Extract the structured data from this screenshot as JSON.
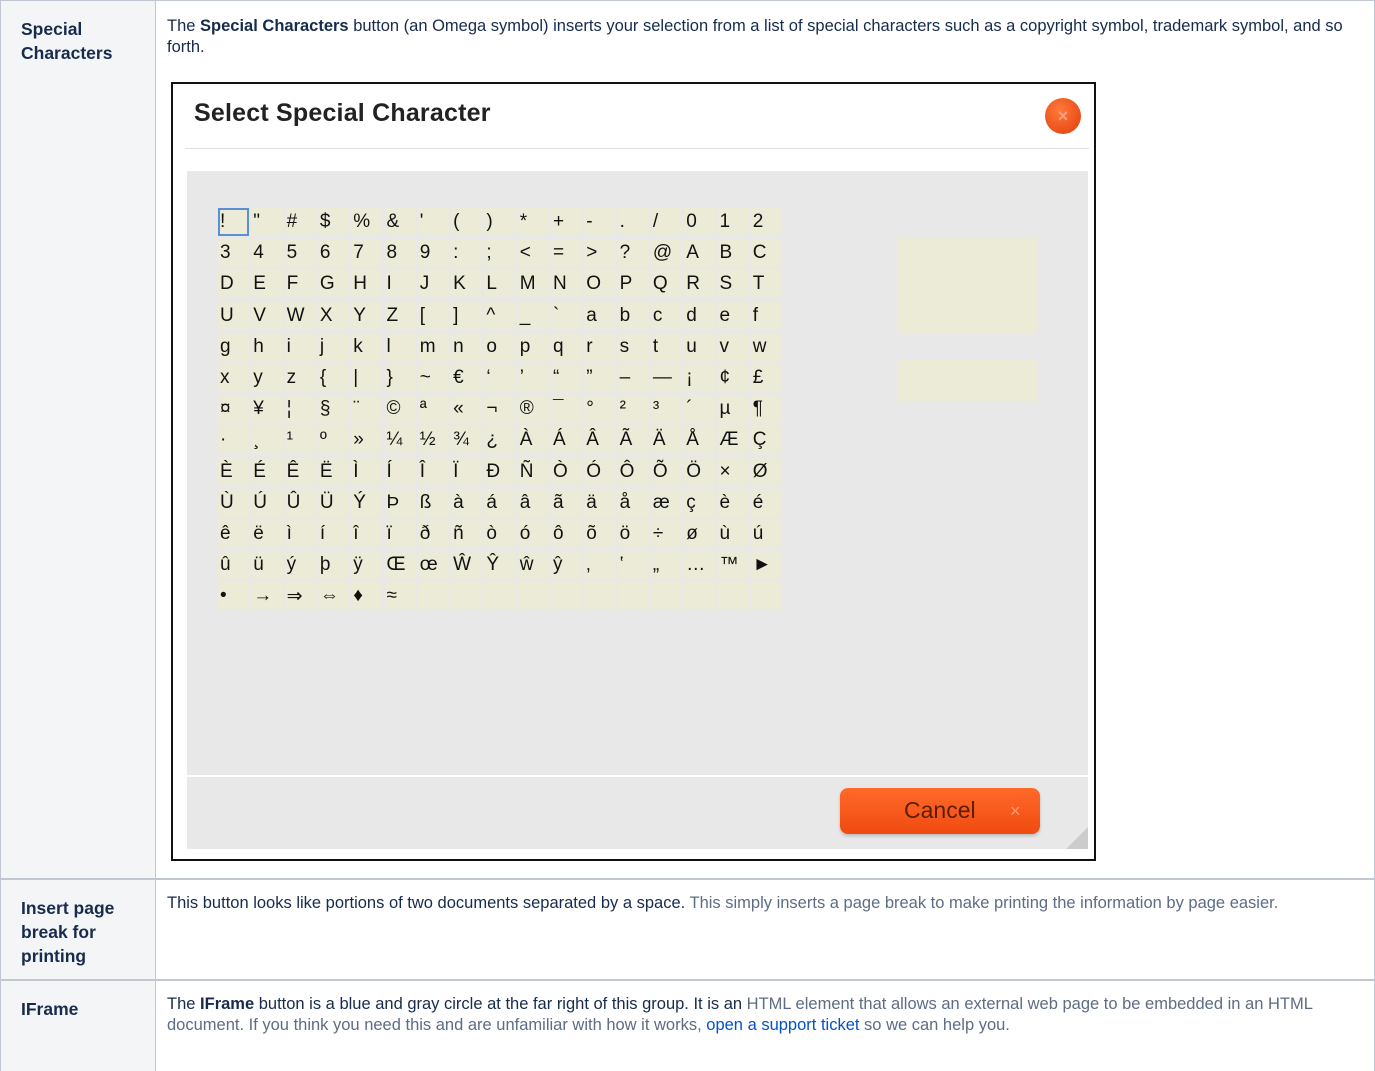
{
  "rows": [
    {
      "label": "Special Characters",
      "description": {
        "p1": "The ",
        "b1": "Special Characters",
        "p2": " button (an Omega symbol) inserts your selection from a list of special characters such as a copyright symbol, trademark symbol, and so forth."
      }
    },
    {
      "label": "Insert page break for printing",
      "description": {
        "p1": "This button looks like portions of two documents separated by a space. ",
        "p2": "This simply inserts a page break to make printing the information by page easier."
      }
    },
    {
      "label": "IFrame",
      "description": {
        "p1": "The ",
        "b1": "IFrame",
        "p2": " button is a blue and gray circle at the far right of this group. It is an ",
        "gray1": "HTML element that allows an external web page to be embedded in an HTML document. If you think you need this and are unfamiliar with how it works, ",
        "link": "open a support ticket",
        "gray2": " so we can help you."
      }
    }
  ],
  "dialog": {
    "title": "Select Special Character",
    "close_icon": "close-icon",
    "cancel_label": "Cancel",
    "cancel_icon": "×",
    "characters": [
      "!",
      "\"",
      "#",
      "$",
      "%",
      "&",
      "'",
      "(",
      ")",
      "*",
      "+",
      "-",
      ".",
      "/",
      "0",
      "1",
      "2",
      "3",
      "4",
      "5",
      "6",
      "7",
      "8",
      "9",
      ":",
      ";",
      "<",
      "=",
      ">",
      "?",
      "@",
      "A",
      "B",
      "C",
      "D",
      "E",
      "F",
      "G",
      "H",
      "I",
      "J",
      "K",
      "L",
      "M",
      "N",
      "O",
      "P",
      "Q",
      "R",
      "S",
      "T",
      "U",
      "V",
      "W",
      "X",
      "Y",
      "Z",
      "[",
      "]",
      "^",
      "_",
      "`",
      "a",
      "b",
      "c",
      "d",
      "e",
      "f",
      "g",
      "h",
      "i",
      "j",
      "k",
      "l",
      "m",
      "n",
      "o",
      "p",
      "q",
      "r",
      "s",
      "t",
      "u",
      "v",
      "w",
      "x",
      "y",
      "z",
      "{",
      "|",
      "}",
      "~",
      "€",
      "‘",
      "’",
      "“",
      "”",
      "–",
      "—",
      "¡",
      "¢",
      "£",
      "¤",
      "¥",
      "¦",
      "§",
      "¨",
      "©",
      "ª",
      "«",
      "¬",
      "®",
      "¯",
      "°",
      "²",
      "³",
      "´",
      "µ",
      "¶",
      "·",
      "¸",
      "¹",
      "º",
      "»",
      "¼",
      "½",
      "¾",
      "¿",
      "À",
      "Á",
      "Â",
      "Ã",
      "Ä",
      "Å",
      "Æ",
      "Ç",
      "È",
      "É",
      "Ê",
      "Ë",
      "Ì",
      "Í",
      "Î",
      "Ï",
      "Ð",
      "Ñ",
      "Ò",
      "Ó",
      "Ô",
      "Õ",
      "Ö",
      "×",
      "Ø",
      "Ù",
      "Ú",
      "Û",
      "Ü",
      "Ý",
      "Þ",
      "ß",
      "à",
      "á",
      "â",
      "ã",
      "ä",
      "å",
      "æ",
      "ç",
      "è",
      "é",
      "ê",
      "ë",
      "ì",
      "í",
      "î",
      "ï",
      "ð",
      "ñ",
      "ò",
      "ó",
      "ô",
      "õ",
      "ö",
      "÷",
      "ø",
      "ù",
      "ú",
      "û",
      "ü",
      "ý",
      "þ",
      "ÿ",
      "Œ",
      "œ",
      "Ŵ",
      "Ŷ",
      "ŵ",
      "ŷ",
      "‚",
      "‛",
      "„",
      "…",
      "™",
      "►",
      "•",
      "→",
      "⇒",
      "⇔",
      "♦",
      "≈",
      "",
      "",
      "",
      "",
      "",
      "",
      "",
      "",
      "",
      "",
      ""
    ],
    "selected_index": 0
  },
  "colors": {
    "border": "#c1c7d0",
    "header_bg": "#f4f5f7",
    "link": "#0052cc",
    "accent": "#f04a10"
  }
}
